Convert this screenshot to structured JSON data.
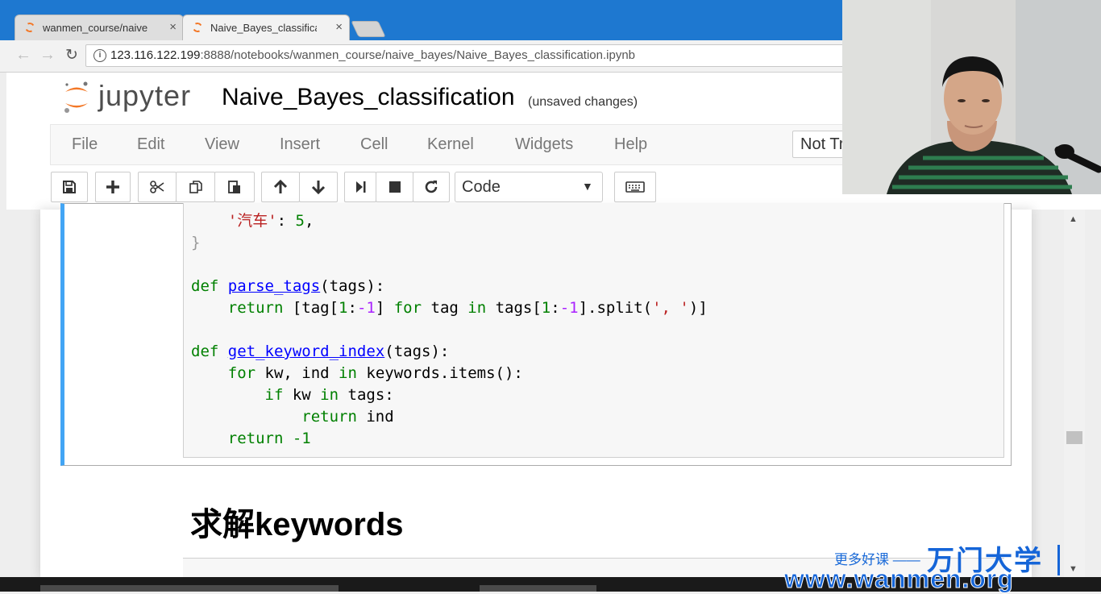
{
  "browser": {
    "tabs": [
      {
        "title": "wanmen_course/naive",
        "active": false
      },
      {
        "title": "Naive_Bayes_classificat",
        "active": true
      }
    ],
    "tab_close_glyph": "×",
    "address": {
      "host": "123.116.122.199",
      "rest": ":8888/notebooks/wanmen_course/naive_bayes/Naive_Bayes_classification.ipynb"
    }
  },
  "jupyter": {
    "logo_text": "jupyter",
    "notebook_title": "Naive_Bayes_classification",
    "save_status": "(unsaved changes)",
    "menu": [
      "File",
      "Edit",
      "View",
      "Insert",
      "Cell",
      "Kernel",
      "Widgets",
      "Help"
    ],
    "kernel_indicator": "Not Trusted",
    "cell_type": "Code",
    "toolbar_icons": [
      "save-icon",
      "plus-icon",
      "cut-icon",
      "copy-icon",
      "paste-icon",
      "arrow-up-icon",
      "arrow-down-icon",
      "run-next-icon",
      "stop-icon",
      "restart-icon",
      "keyboard-icon"
    ]
  },
  "code": {
    "line1_str": "'汽车'",
    "line1_rest": ": ",
    "line1_num": "5",
    "line1_comma": ",",
    "line2": "}",
    "def": "def",
    "fn1": "parse_tags",
    "fn1_args": "(tags):",
    "return": "return",
    "line4_a": " [tag[",
    "n1": "1",
    "colon": ":",
    "minus1": "-1",
    "line4_b": "] ",
    "for": "for",
    "line4_c": " tag ",
    "in": "in",
    "line4_d": " tags[",
    "line4_e": "].split(",
    "split_str": "', '",
    "line4_f": ")]",
    "fn2": "get_keyword_index",
    "fn2_args": "(tags):",
    "line7_a": " kw, ind ",
    "line7_b": " keywords.items():",
    "if": "if",
    "line8_a": " kw ",
    "line8_b": " tags:",
    "line9_a": " ind",
    "ret_minus": "-1"
  },
  "markdown": {
    "heading": "求解keywords"
  },
  "watermark": {
    "tagline": "更多好课 ——",
    "brand": "万门大学",
    "url": "www.wanmen.org"
  },
  "colors": {
    "cell_border": "#42a5f5",
    "keyword": "#008000",
    "string": "#ba2121",
    "function": "#0000ff",
    "jupyter_orange": "#f37726"
  }
}
